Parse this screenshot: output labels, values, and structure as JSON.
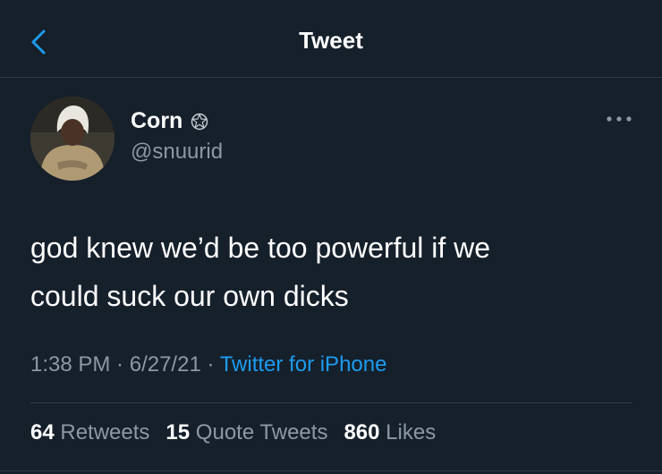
{
  "header": {
    "title": "Tweet",
    "back_icon": "chevron-left-icon"
  },
  "author": {
    "name": "Corn",
    "badge_icon": "pentagram-icon",
    "handle": "@snuurid"
  },
  "tweet": {
    "line1": "god knew we’d be too powerful if we",
    "line2": "could suck our own dicks"
  },
  "meta": {
    "time": "1:38 PM",
    "sep1": " · ",
    "date": "6/27/21",
    "sep2": " · ",
    "source": "Twitter for iPhone"
  },
  "stats": {
    "retweets_count": "64",
    "retweets_label": "Retweets",
    "quotes_count": "15",
    "quotes_label": "Quote Tweets",
    "likes_count": "860",
    "likes_label": "Likes"
  },
  "colors": {
    "background": "#15202b",
    "accent": "#1d9bf0",
    "secondary_text": "#8b98a5",
    "primary_text": "#ffffff"
  }
}
